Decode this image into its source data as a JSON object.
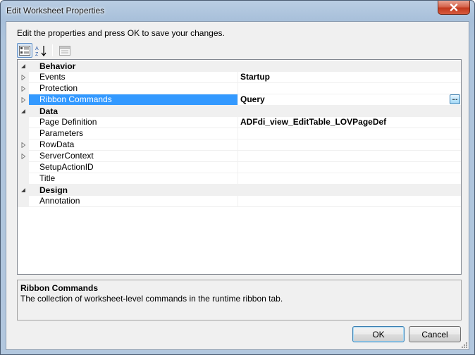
{
  "window": {
    "title": "Edit Worksheet Properties"
  },
  "instructions": "Edit the properties and press OK to save your changes.",
  "toolbar": {
    "categorized_icon": "categorized-icon",
    "alphabetical_icon": "alphabetical-icon",
    "property_pages_icon": "property-pages-icon"
  },
  "grid": {
    "categories": [
      {
        "name": "Behavior",
        "properties": [
          {
            "name": "Events",
            "value": "Startup",
            "expandable": true
          },
          {
            "name": "Protection",
            "value": "",
            "expandable": true
          },
          {
            "name": "Ribbon Commands",
            "value": "Query",
            "expandable": true,
            "selected": true,
            "ellipsis": "..."
          }
        ]
      },
      {
        "name": "Data",
        "properties": [
          {
            "name": "Page Definition",
            "value": "ADFdi_view_EditTable_LOVPageDef",
            "expandable": false
          },
          {
            "name": "Parameters",
            "value": "",
            "expandable": false
          },
          {
            "name": "RowData",
            "value": "",
            "expandable": true
          },
          {
            "name": "ServerContext",
            "value": "",
            "expandable": true
          },
          {
            "name": "SetupActionID",
            "value": "",
            "expandable": false
          },
          {
            "name": "Title",
            "value": "",
            "expandable": false
          }
        ]
      },
      {
        "name": "Design",
        "properties": [
          {
            "name": "Annotation",
            "value": "",
            "expandable": false
          }
        ]
      }
    ]
  },
  "description": {
    "title": "Ribbon Commands",
    "text": "The collection of worksheet-level commands in the runtime ribbon tab."
  },
  "buttons": {
    "ok_label": "OK",
    "cancel_label": "Cancel"
  },
  "colors": {
    "selection": "#3399ff",
    "category_background": "#f0f0f0",
    "close_button": "#c2391e"
  }
}
